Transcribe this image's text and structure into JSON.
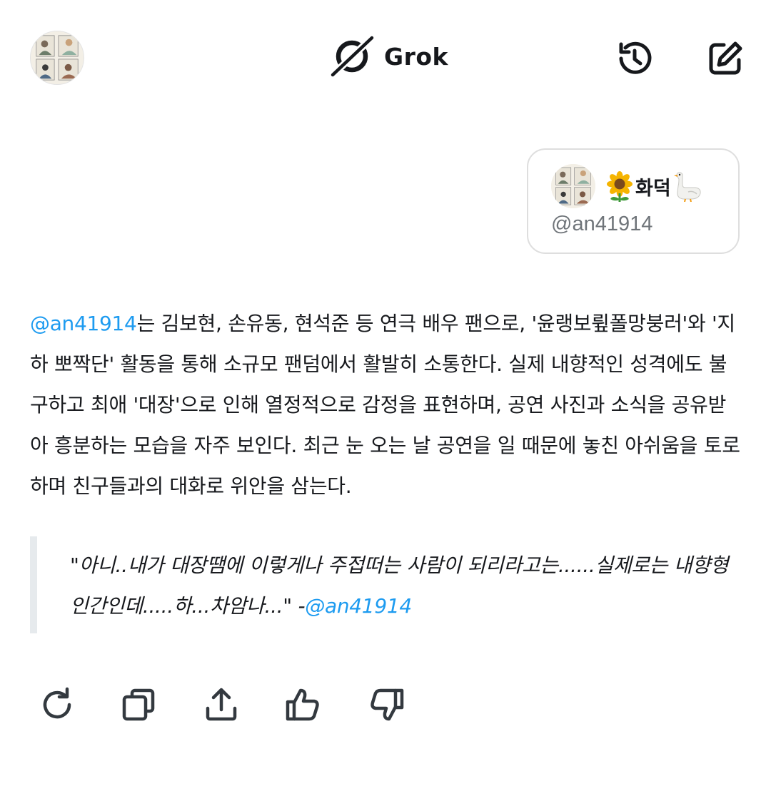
{
  "header": {
    "app_name": "Grok",
    "icons": [
      "avatar-image",
      "grok-logo-icon",
      "history-icon",
      "compose-icon"
    ]
  },
  "user_card": {
    "display_name": "화덕",
    "emoji_before": "sunflower-icon",
    "emoji_after": "goose-icon",
    "handle": "@an41914"
  },
  "response": {
    "mention": "@an41914",
    "body": "는 김보현, 손유동, 현석준 등 연극 배우 팬으로, '윤랭보륖폴망붕러'와 '지하 뽀짝단' 활동을 통해 소규모 팬덤에서 활발히 소통한다. 실제 내향적인 성격에도 불구하고 최애 '대장'으로 인해 열정적으로 감정을 표현하며, 공연 사진과 소식을 공유받아 흥분하는 모습을 자주 보인다. 최근 눈 오는 날 공연을 일 때문에 놓친 아쉬움을 토로하며 친구들과의 대화로 위안을 삼는다.",
    "quote_text": "\"아니..내가 대장땜에 이렇게나 주접떠는 사람이 되리라고는......실제로는 내향형인간인데.....하...차암나...\" -",
    "quote_mention": "@an41914"
  },
  "actions": [
    "regenerate-icon",
    "copy-icon",
    "share-icon",
    "thumbs-up-icon",
    "thumbs-down-icon"
  ],
  "colors": {
    "mention": "#1d9bf0",
    "text": "#16181c",
    "muted": "#6f7479",
    "border": "#dedede",
    "quote_bar": "#e6eaed"
  }
}
